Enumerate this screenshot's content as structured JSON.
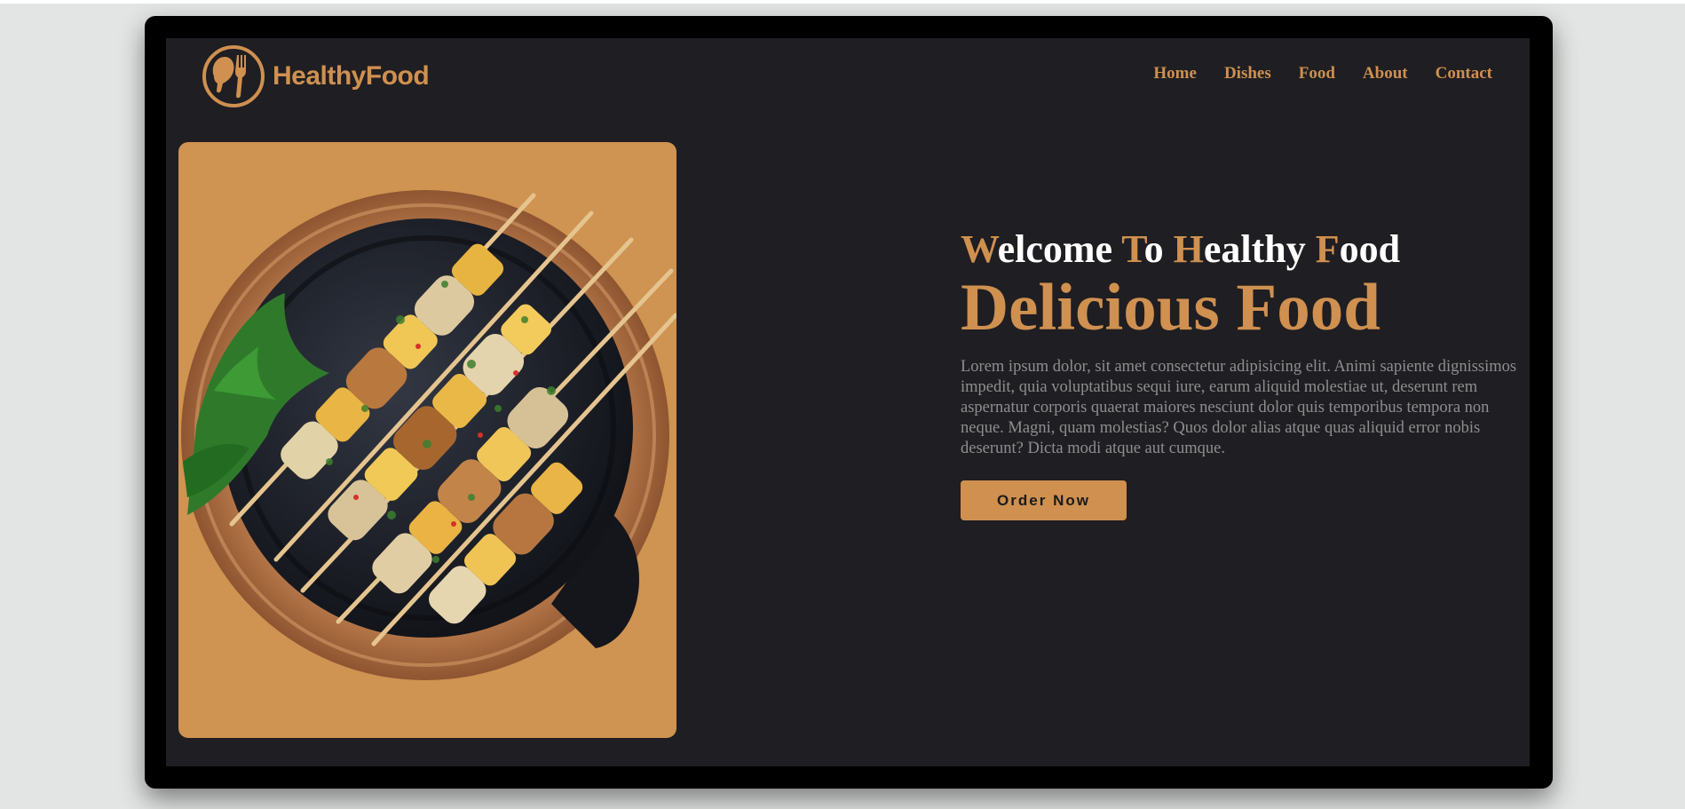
{
  "brand": {
    "name": "HealthyFood"
  },
  "nav": {
    "items": [
      {
        "label": "Home"
      },
      {
        "label": "Dishes"
      },
      {
        "label": "Food"
      },
      {
        "label": "About"
      },
      {
        "label": "Contact"
      }
    ]
  },
  "hero": {
    "welcome_words": [
      {
        "first": "W",
        "rest": "elcome"
      },
      {
        "first": "T",
        "rest": "o"
      },
      {
        "first": "H",
        "rest": "ealthy"
      },
      {
        "first": "F",
        "rest": "ood"
      }
    ],
    "title": "Delicious Food",
    "description": "Lorem ipsum dolor, sit amet consectetur adipisicing elit. Animi sapiente dignissimos impedit, quia voluptatibus sequi iure, earum aliquid molestiae ut, deserunt rem aspernatur corporis quaerat maiores nesciunt dolor quis temporibus tempora non neque. Magni, quam molestias? Quos dolor alias atque quas aliquid error nobis deserunt? Dicta modi atque aut cumque.",
    "cta_label": "Order Now",
    "image": "grilled-chicken-skewers-photo"
  },
  "colors": {
    "page_background": "#e3e5e4",
    "screen_background": "#1f1e22",
    "accent": "#cf9050",
    "image_card": "#cf9352",
    "text_muted": "#8e8e8e"
  }
}
